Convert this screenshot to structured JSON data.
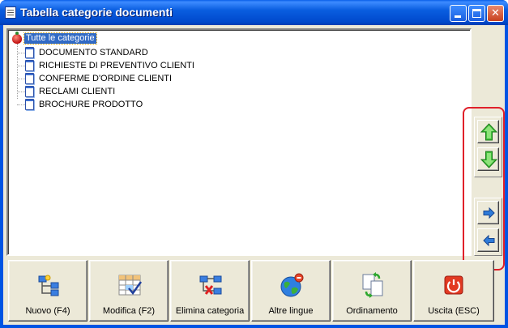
{
  "window": {
    "title": "Tabella categorie documenti",
    "controls": {
      "minimize": "_",
      "maximize": "□",
      "close": "✕"
    }
  },
  "tree": {
    "root": {
      "label": "Tutte le categorie",
      "icon": "strawberry-icon"
    },
    "items": [
      {
        "label": "DOCUMENTO STANDARD",
        "icon": "document-icon"
      },
      {
        "label": "RICHIESTE DI PREVENTIVO CLIENTI",
        "icon": "document-icon"
      },
      {
        "label": "CONFERME D'ORDINE CLIENTI",
        "icon": "document-icon"
      },
      {
        "label": "RECLAMI CLIENTI",
        "icon": "document-icon"
      },
      {
        "label": "BROCHURE PRODOTTO",
        "icon": "document-icon"
      }
    ]
  },
  "side_buttons": [
    {
      "name": "move-up",
      "icon": "green-arrow-up-icon"
    },
    {
      "name": "move-down",
      "icon": "green-arrow-down-icon"
    },
    {
      "name": "indent",
      "icon": "blue-arrow-right-icon"
    },
    {
      "name": "outdent",
      "icon": "blue-arrow-left-icon"
    }
  ],
  "toolbar": {
    "new_label": "Nuovo (F4)",
    "edit_label": "Modifica (F2)",
    "delete_label": "Elimina categoria",
    "languages_label": "Altre lingue",
    "sort_label": "Ordinamento",
    "exit_label": "Uscita (ESC)"
  },
  "colors": {
    "title_bar": "#0054e3",
    "selection": "#316ac5",
    "highlight_box": "#e0202a",
    "face": "#ece9d8"
  }
}
